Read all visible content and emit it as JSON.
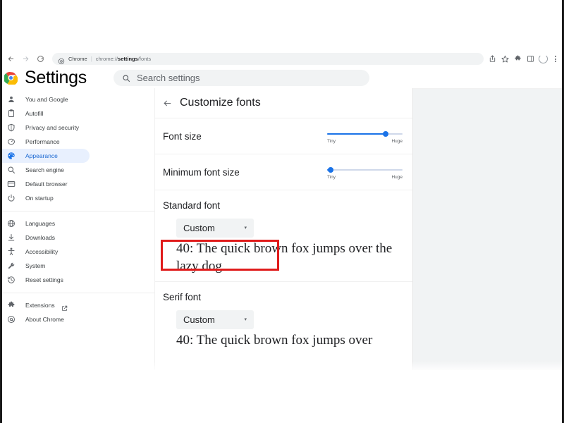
{
  "browser": {
    "nav": {
      "back_icon": "arrow-left-icon",
      "forward_icon": "arrow-right-icon",
      "reload_icon": "reload-icon"
    },
    "omnibox": {
      "page_icon": "chrome-settings-page-icon",
      "chip_label": "Chrome",
      "separator": "|",
      "url_prefix": "chrome://",
      "url_bold": "settings",
      "url_suffix": "/fonts",
      "full_url": "chrome://settings/fonts"
    },
    "actions": [
      {
        "name": "share-icon",
        "label": "Share"
      },
      {
        "name": "bookmark-star-icon",
        "label": "Bookmark this tab"
      },
      {
        "name": "extensions-puzzle-icon",
        "label": "Extensions"
      },
      {
        "name": "side-panel-icon",
        "label": "Side panel"
      },
      {
        "name": "profile-avatar-icon",
        "label": "Profile"
      },
      {
        "name": "more-menu-kebab-icon",
        "label": "Customize and control Google Chrome"
      }
    ]
  },
  "settings": {
    "logo": "chrome-logo",
    "title": "Settings",
    "search": {
      "icon": "search-icon",
      "placeholder": "Search settings",
      "value": ""
    },
    "sidebar": {
      "groups": [
        {
          "items": [
            {
              "label": "You and Google",
              "icon": "person-icon",
              "active": false
            },
            {
              "label": "Autofill",
              "icon": "autofill-icon",
              "active": false
            },
            {
              "label": "Privacy and security",
              "icon": "shield-icon",
              "active": false
            },
            {
              "label": "Performance",
              "icon": "speedometer-icon",
              "active": false
            },
            {
              "label": "Appearance",
              "icon": "palette-icon",
              "active": true
            },
            {
              "label": "Search engine",
              "icon": "search-icon",
              "active": false
            },
            {
              "label": "Default browser",
              "icon": "browser-window-icon",
              "active": false
            },
            {
              "label": "On startup",
              "icon": "power-icon",
              "active": false
            }
          ]
        },
        {
          "items": [
            {
              "label": "Languages",
              "icon": "globe-icon",
              "active": false
            },
            {
              "label": "Downloads",
              "icon": "download-icon",
              "active": false
            },
            {
              "label": "Accessibility",
              "icon": "accessibility-icon",
              "active": false
            },
            {
              "label": "System",
              "icon": "wrench-icon",
              "active": false
            },
            {
              "label": "Reset settings",
              "icon": "history-restore-icon",
              "active": false
            }
          ]
        },
        {
          "items": [
            {
              "label": "Extensions",
              "icon": "puzzle-icon",
              "active": false,
              "external": true,
              "external_icon": "external-link-icon"
            },
            {
              "label": "About Chrome",
              "icon": "chrome-circle-icon",
              "active": false
            }
          ]
        }
      ]
    }
  },
  "main": {
    "back_icon": "back-arrow-icon",
    "page_title": "Customize fonts",
    "font_size": {
      "label": "Font size",
      "min_label": "Tiny",
      "max_label": "Huge",
      "percent": 78
    },
    "minimum_font_size": {
      "label": "Minimum font size",
      "min_label": "Tiny",
      "max_label": "Huge",
      "percent": 5
    },
    "standard_font": {
      "label": "Standard font",
      "selected": "Custom",
      "caret_icon": "chevron-down-icon",
      "sample": "40: The quick brown fox jumps over the lazy dog"
    },
    "serif_font": {
      "label": "Serif font",
      "selected": "Custom",
      "caret_icon": "chevron-down-icon",
      "sample": "40: The quick brown fox jumps over"
    }
  },
  "annotation": {
    "target": "standard-font-dropdown",
    "color": "#e01b1b"
  },
  "colors": {
    "accent_blue": "#1a73e8",
    "active_nav_bg": "#e8f0fe",
    "active_nav_text": "#1967d2",
    "page_bg": "#f1f3f4",
    "card_bg": "#ffffff",
    "text_primary": "#202124",
    "text_secondary": "#5f6368",
    "annotation_red": "#e01b1b"
  }
}
